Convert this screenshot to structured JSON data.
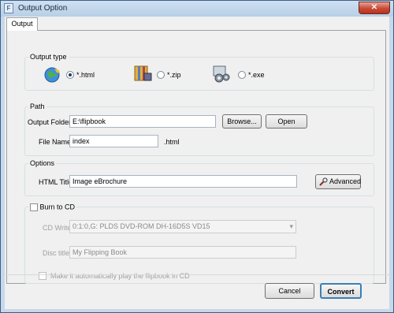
{
  "window": {
    "title": "Output Option",
    "close_glyph": "✕"
  },
  "tab": {
    "label": "Output"
  },
  "output_type": {
    "title": "Output type",
    "options": [
      {
        "label": "*.html",
        "icon": "globe-icon",
        "selected": true
      },
      {
        "label": "*.zip",
        "icon": "archive-icon",
        "selected": false
      },
      {
        "label": "*.exe",
        "icon": "gears-icon",
        "selected": false
      }
    ]
  },
  "path": {
    "title": "Path",
    "folder_label": "Output Folder:",
    "folder_value": "E:\\flipbook",
    "browse_label": "Browse...",
    "open_label": "Open",
    "filename_label": "File Name:",
    "filename_value": "index",
    "ext": ".html"
  },
  "options": {
    "title": "Options",
    "html_title_label": "HTML Title:",
    "html_title_value": "Image eBrochure",
    "advanced_label": "Advanced"
  },
  "burn": {
    "title": "Burn to CD",
    "writer_label": "CD Writer",
    "writer_value": "0:1:0,G: PLDS     DVD-ROM DH-16D5S VD15",
    "disc_label": "Disc title:",
    "disc_value": "My Flipping Book",
    "autoplay_label": "Make it automatically play the flipbook in CD"
  },
  "footer": {
    "cancel_label": "Cancel",
    "convert_label": "Convert"
  },
  "colors": {
    "titlebar": "#c6d8ea",
    "close": "#c84a36",
    "panel": "#f0f0f0"
  }
}
